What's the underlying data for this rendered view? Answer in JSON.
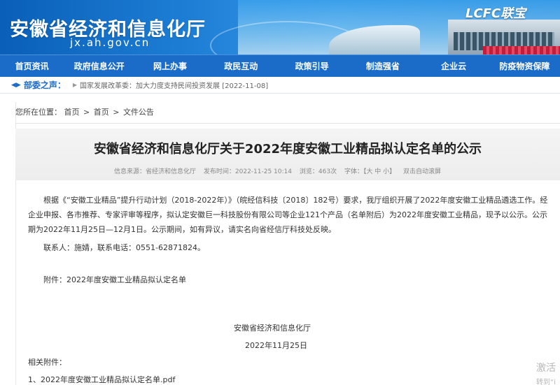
{
  "header": {
    "site_title": "安徽省经济和信息化厅",
    "site_url": "jx.ah.gov.cn",
    "banner_logo_text": "LCFC联宝"
  },
  "nav": {
    "items": [
      "首页资讯",
      "政府信息公开",
      "网上办事",
      "政民互动",
      "政策引导",
      "制造强省",
      "企业云",
      "防疫物资保障"
    ]
  },
  "notice": {
    "label": "部委之声：",
    "text": "国家发展改革委：加大力度支持民间投资发展 [2022-11-08]"
  },
  "breadcrumb": {
    "prefix": "您所在位置：",
    "items": [
      "首页",
      "首页",
      "文件公告"
    ],
    "separator": ">"
  },
  "article": {
    "title": "安徽省经济和信息化厅关于2022年度安徽工业精品拟认定名单的公示",
    "meta": {
      "source": "信息来源：省经济和信息化厅",
      "published": "发布时间：2022-11-25 10:14",
      "views": "浏览：463次",
      "font_size": "字体：【大 中 小】",
      "autoscroll": "双击自动滚屏"
    },
    "paragraph1": "根据《“安徽工业精品”提升行动计划（2018-2022年）》（皖经信科技〔2018〕182号）要求，我厅组织开展了2022年度安徽工业精品遴选工作。经企业申报、各市推荐、专家评审等程序，拟认定安徽巨一科技股份有限公司等企业121个产品（名单附后）为2022年度安徽工业精品，现予以公示。公示期为2022年11月25日—12月1日。公示期间，如有异议，请实名向省经信厅科技处反映。",
    "contact": "联系人：施婧，联系电话：0551-62871824。",
    "attachment_note": "附件：2022年度安徽工业精品拟认定名单",
    "signature_org": "安徽省经济和信息化厅",
    "signature_date": "2022年11月25日",
    "related_label": "相关附件：",
    "attachment_file": "1、2022年度安徽工业精品拟认定名单.pdf"
  },
  "watermark": {
    "line1": "激活",
    "line2": "转到“i"
  },
  "colors": {
    "nav_bg": "#1a6cc8",
    "accent": "#1a6cc8",
    "title_band": "#f0f0f0"
  }
}
